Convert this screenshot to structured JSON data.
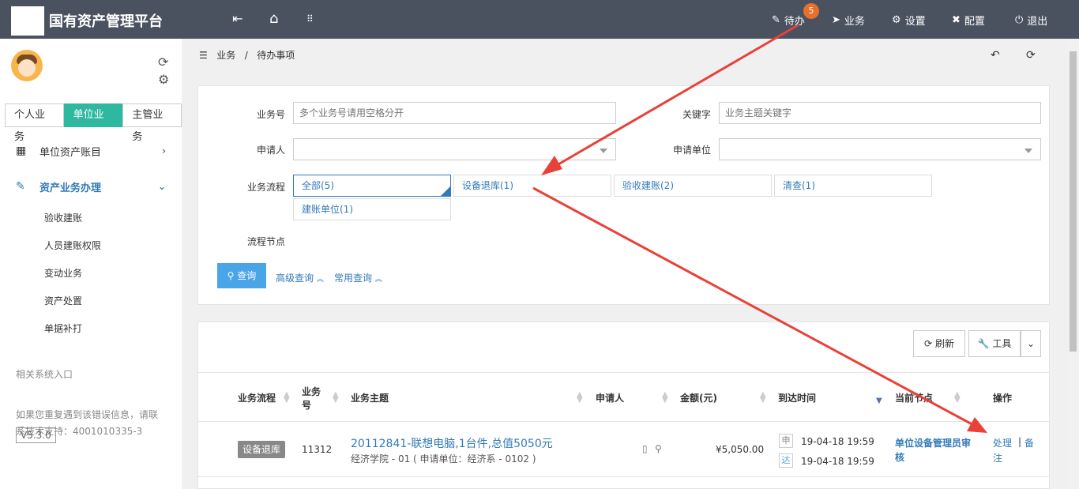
{
  "header": {
    "title": "国有资产管理平台",
    "pending_label": "待办",
    "pending_count": "5",
    "business_label": "业务",
    "settings_label": "设置",
    "config_label": "配置",
    "logout_label": "退出"
  },
  "sidebar": {
    "tabs": [
      "个人业务",
      "单位业务",
      "主管业务"
    ],
    "menu_account": "单位资产账目",
    "menu_process": "资产业务办理",
    "submenu": [
      "验收建账",
      "人员建账权限",
      "变动业务",
      "资产处置",
      "单据补打"
    ],
    "related_entry": "相关系统入口",
    "note_line1": "如果您重复遇到该错误信息，请联",
    "note_line2": "系技术支持：4001010335-3",
    "version": "V5.3.0"
  },
  "breadcrumb": {
    "root": "业务",
    "separator": "/",
    "current": "待办事项"
  },
  "search": {
    "business_no_label": "业务号",
    "business_no_placeholder": "多个业务号请用空格分开",
    "keyword_label": "关键字",
    "keyword_placeholder": "业务主题关键字",
    "applicant_label": "申请人",
    "unit_label": "申请单位",
    "flow_label": "业务流程",
    "flow_options": [
      "全部(5)",
      "设备退库(1)",
      "验收建账(2)",
      "清查(1)",
      "建账单位(1)"
    ],
    "node_label": "流程节点",
    "query_button": "查询",
    "advanced_link": "高级查询",
    "common_link": "常用查询"
  },
  "toolbar": {
    "refresh_label": "刷新",
    "tools_label": "工具"
  },
  "table": {
    "headers": {
      "flow": "业务流程",
      "no_line1": "业务",
      "no_line2": "号",
      "subject": "业务主题",
      "applicant": "申请人",
      "amount": "金额(元)",
      "arrival": "到达时间",
      "node": "当前节点",
      "action": "操作"
    },
    "rows": [
      {
        "flow": "设备退库",
        "no": "11312",
        "subject": "20112841-联想电脑,1台件,总值5050元",
        "subtitle": "经济学院 - 01 ( 申请单位：经济系 - 0102 )",
        "amount": "¥5,050.00",
        "apply_char": "申",
        "apply_time": "19-04-18 19:59",
        "arrive_char": "达",
        "arrive_time": "19-04-18 19:59",
        "node_line1": "单位设备管理员审",
        "node_line2": "核",
        "action_process": "处理",
        "action_sep": "|",
        "action_note_line1": "备",
        "action_note_line2": "注"
      }
    ]
  },
  "colors": {
    "topbar": "#4a5260",
    "accent": "#2fb8a0",
    "primary": "#4aa4e8",
    "link": "#337ab7",
    "annotation_arrow": "#e8413a"
  }
}
